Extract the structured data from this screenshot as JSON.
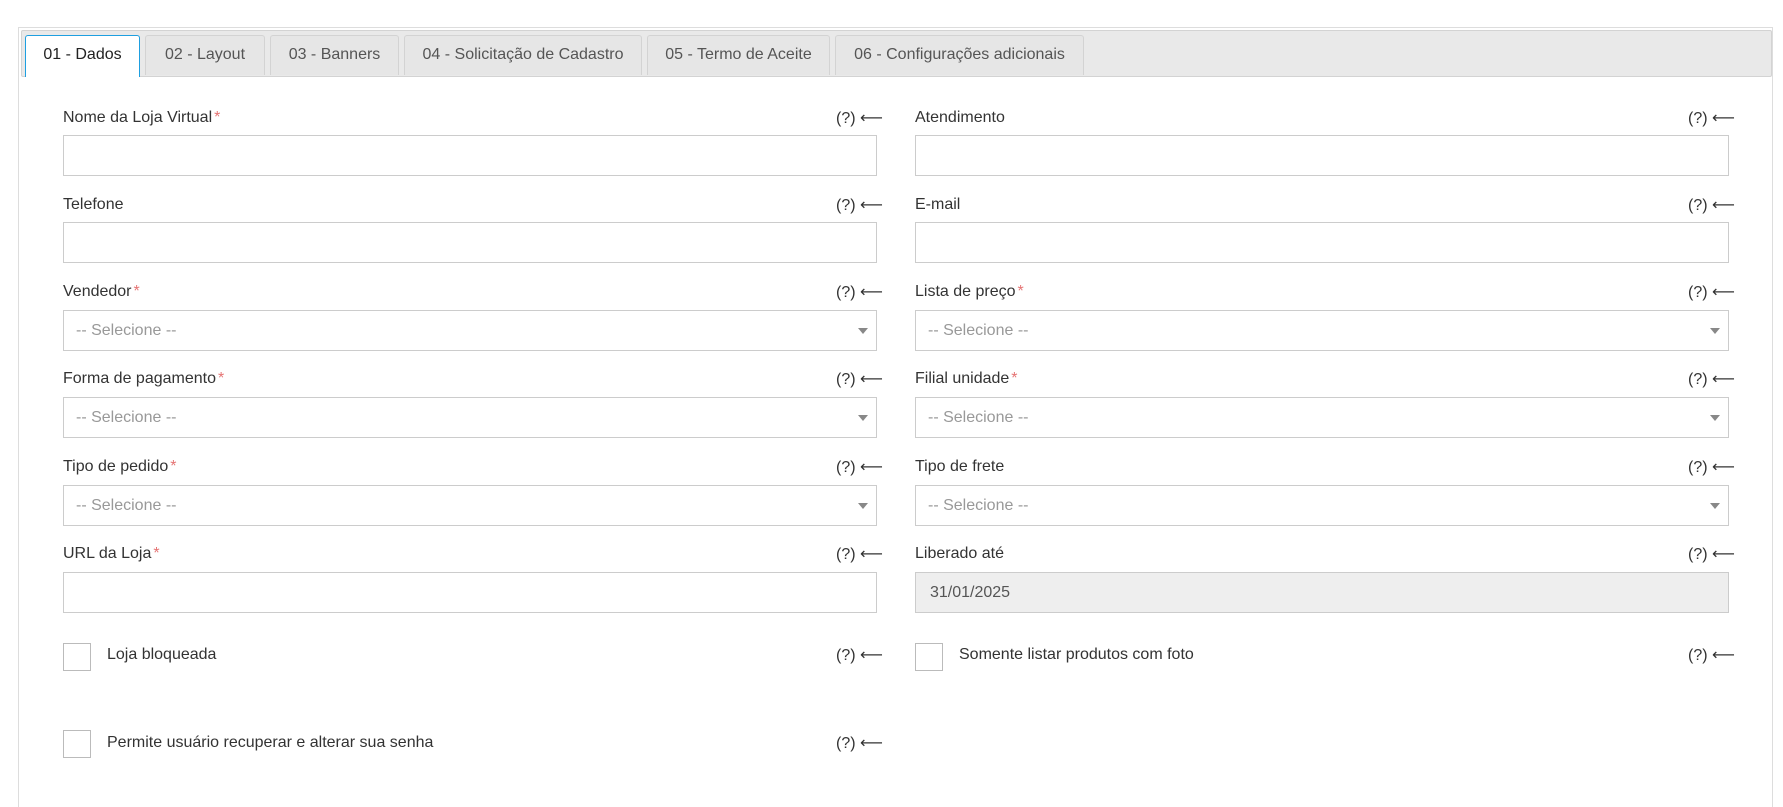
{
  "tabs": [
    {
      "label": "01 - Dados",
      "active": true
    },
    {
      "label": "02 - Layout"
    },
    {
      "label": "03 - Banners"
    },
    {
      "label": "04 - Solicitação de Cadastro"
    },
    {
      "label": "05 - Termo de Aceite"
    },
    {
      "label": "06 - Configurações adicionais"
    }
  ],
  "help_text": "(?) ⟵",
  "required_mark": "*",
  "fields": {
    "store_name": {
      "label": "Nome da Loja Virtual",
      "value": ""
    },
    "service": {
      "label": "Atendimento",
      "value": ""
    },
    "phone": {
      "label": "Telefone",
      "value": ""
    },
    "email": {
      "label": "E-mail",
      "value": ""
    },
    "seller": {
      "label": "Vendedor",
      "selected": "-- Selecione --"
    },
    "price_list": {
      "label": "Lista de preço",
      "selected": "-- Selecione --"
    },
    "payment_method": {
      "label": "Forma de pagamento",
      "selected": "-- Selecione --"
    },
    "branch_unit": {
      "label": "Filial unidade",
      "selected": "-- Selecione --"
    },
    "order_type": {
      "label": "Tipo de pedido",
      "selected": "-- Selecione --"
    },
    "freight_type": {
      "label": "Tipo de frete",
      "selected": "-- Selecione --"
    },
    "store_url": {
      "label": "URL da Loja",
      "value": ""
    },
    "released_until": {
      "label": "Liberado até",
      "value": "31/01/2025"
    }
  },
  "checkboxes": {
    "store_blocked": {
      "label": "Loja bloqueada",
      "checked": false
    },
    "only_with_photo": {
      "label": "Somente listar produtos com foto",
      "checked": false
    },
    "allow_password_recovery": {
      "label": "Permite usuário recuperar e alterar sua senha",
      "checked": false
    }
  },
  "colors": {
    "required": "#e57373",
    "active_tab_border": "#1e9fe0"
  }
}
